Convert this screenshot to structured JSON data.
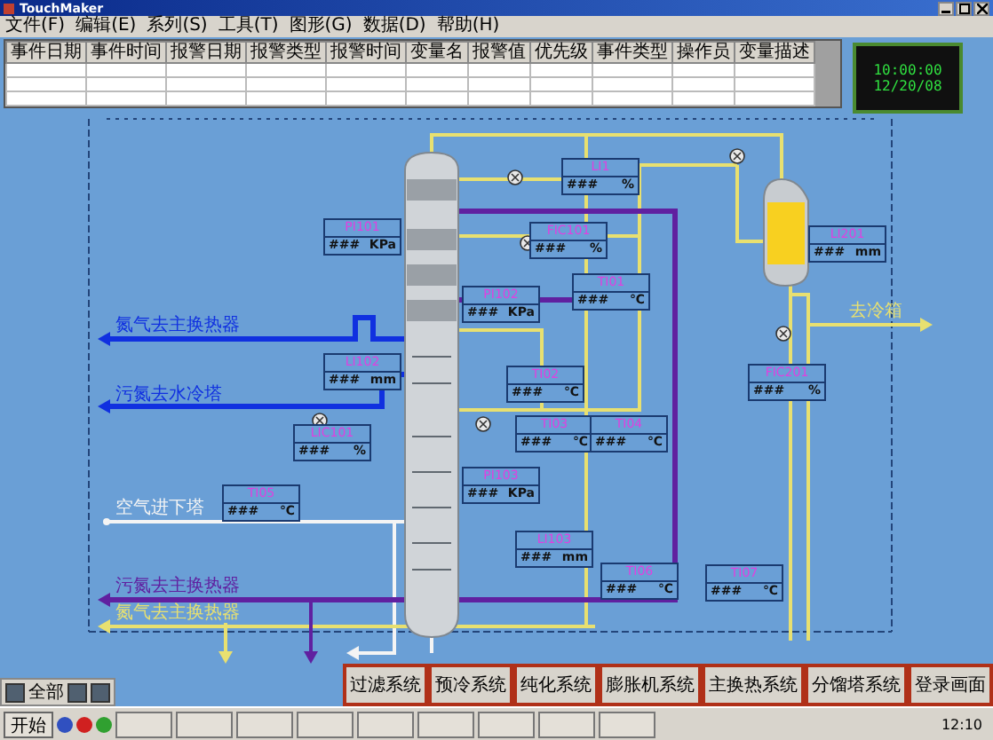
{
  "window": {
    "title": "TouchMaker"
  },
  "menu": [
    "文件(F)",
    "编辑(E)",
    "系列(S)",
    "工具(T)",
    "图形(G)",
    "数据(D)",
    "帮助(H)"
  ],
  "alarm_table": {
    "columns": [
      "事件日期",
      "事件时间",
      "报警日期",
      "报警类型",
      "报警时间",
      "变量名",
      "报警值",
      "优先级",
      "事件类型",
      "操作员",
      "变量描述"
    ]
  },
  "clock": {
    "time": "10:00:00",
    "date": "12/20/08"
  },
  "lines": [
    {
      "label": "氮气去主换热器",
      "color": "#1030e0"
    },
    {
      "label": "污氮去水冷塔",
      "color": "#1030e0"
    },
    {
      "label": "空气进下塔",
      "color": "#f4f4f4"
    },
    {
      "label": "污氮去主换热器",
      "color": "#6020a0"
    },
    {
      "label": "氮气去主换热器",
      "color": "#e8e070"
    },
    {
      "label": "去冷箱",
      "color": "#e8e070"
    }
  ],
  "instruments": [
    {
      "tag": "PI101",
      "value": "###",
      "unit": "KPa"
    },
    {
      "tag": "LI1",
      "value": "###",
      "unit": "%"
    },
    {
      "tag": "FIC101",
      "value": "###",
      "unit": "%"
    },
    {
      "tag": "PI102",
      "value": "###",
      "unit": "KPa"
    },
    {
      "tag": "TI01",
      "value": "###",
      "unit": "℃"
    },
    {
      "tag": "LI102",
      "value": "###",
      "unit": "mm"
    },
    {
      "tag": "LIC101",
      "value": "###",
      "unit": "%"
    },
    {
      "tag": "TI02",
      "value": "###",
      "unit": "℃"
    },
    {
      "tag": "TI03",
      "value": "###",
      "unit": "℃"
    },
    {
      "tag": "TI04",
      "value": "###",
      "unit": "℃"
    },
    {
      "tag": "TI05",
      "value": "###",
      "unit": "℃"
    },
    {
      "tag": "PI103",
      "value": "###",
      "unit": "KPa"
    },
    {
      "tag": "LI103",
      "value": "###",
      "unit": "mm"
    },
    {
      "tag": "TI06",
      "value": "###",
      "unit": "℃"
    },
    {
      "tag": "TI07",
      "value": "###",
      "unit": "℃"
    },
    {
      "tag": "LI201",
      "value": "###",
      "unit": "mm"
    },
    {
      "tag": "FIC201",
      "value": "###",
      "unit": "%"
    }
  ],
  "nav_buttons": [
    "过滤系统",
    "预冷系统",
    "纯化系统",
    "膨胀机系统",
    "主换热系统",
    "分馏塔系统",
    "登录画面"
  ],
  "mini_toolbar": {
    "label": "全部"
  },
  "taskbar": {
    "start": "开始",
    "clock": "12:10"
  }
}
